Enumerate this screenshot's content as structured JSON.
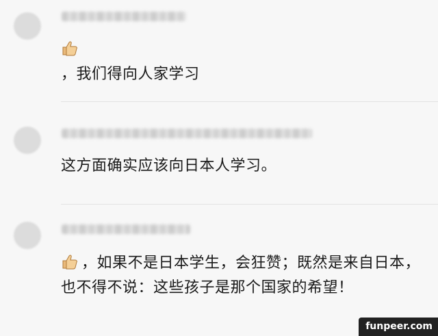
{
  "comments": [
    {
      "name": "",
      "has_thumb_icon": true,
      "line1": "",
      "text": "，我们得向人家学习"
    },
    {
      "name": "",
      "has_thumb_icon": false,
      "text": "这方面确实应该向日本人学习。"
    },
    {
      "name": "",
      "has_thumb_icon": true,
      "text": "，如果不是日本学生，会狂赞；既然是来自日本，也不得不说：这些孩子是那个国家的希望！"
    }
  ],
  "watermark": "funpeer.com",
  "icons": {
    "reaction": "thumbs-up-icon"
  }
}
